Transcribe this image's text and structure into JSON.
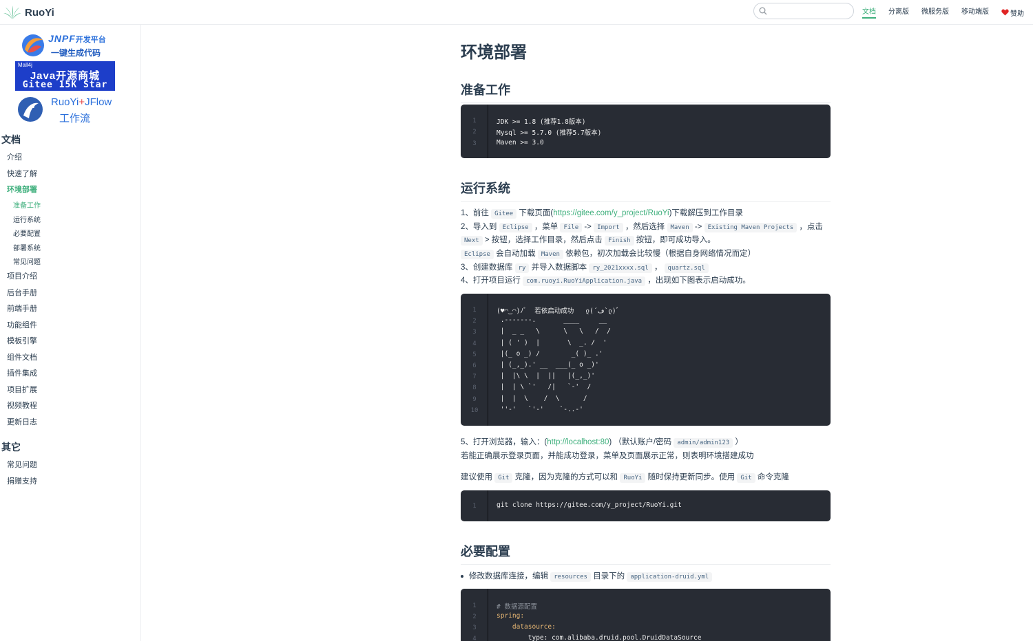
{
  "navbar": {
    "brand": "RuoYi",
    "search_value": "",
    "links": [
      "文档",
      "分离版",
      "微服务版",
      "移动端版"
    ],
    "sponsor": "赞助"
  },
  "sidebar": {
    "ads": {
      "jnpf_title": "JNPF",
      "jnpf_title_suffix": "开发平台",
      "jnpf_sub": "一键生成代码",
      "mall_small": "Mall4j",
      "mall_a": "Java开源商城",
      "mall_b": "Gitee 15K Star",
      "flow_a1": "RuoYi",
      "flow_plus": "+",
      "flow_a2": "JFlow",
      "flow_b": "工作流"
    },
    "group_docs": "文档",
    "items": [
      "介绍",
      "快速了解",
      "环境部署"
    ],
    "sub_items": [
      "准备工作",
      "运行系统",
      "必要配置",
      "部署系统",
      "常见问题"
    ],
    "items2": [
      "项目介绍",
      "后台手册",
      "前端手册",
      "功能组件",
      "模板引擎",
      "组件文档",
      "插件集成",
      "项目扩展",
      "视频教程",
      "更新日志"
    ],
    "group_other": "其它",
    "other_items": [
      "常见问题",
      "捐赠支持"
    ]
  },
  "content": {
    "title": "环境部署",
    "h_prepare": "准备工作",
    "prepare_code": [
      "JDK >= 1.8 (推荐1.8版本)",
      "Mysql >= 5.7.0 (推荐5.7版本)",
      "Maven >= 3.0"
    ],
    "h_run": "运行系统",
    "run": {
      "l1_a": "1、前往",
      "l1_code": "Gitee",
      "l1_b": "下载页面(",
      "l1_link": "https://gitee.com/y_project/RuoYi",
      "l1_c": ")下载解压到工作目录",
      "l2_a": "2、导入到",
      "l2_code1": "Eclipse",
      "l2_b": "，菜单",
      "l2_code2": "File",
      "l2_arrow1": "->",
      "l2_code3": "Import",
      "l2_c": "，然后选择",
      "l2_code4": "Maven",
      "l2_arrow2": "->",
      "l2_code5": "Existing Maven Projects",
      "l2_d": "，点击",
      "l3_code1": "Next",
      "l3_a": "> 按钮，选择工作目录，然后点击",
      "l3_code2": "Finish",
      "l3_b": "按钮，即可成功导入。",
      "l4_code1": "Eclipse",
      "l4_a": "会自动加载",
      "l4_code2": "Maven",
      "l4_b": "依赖包，初次加载会比较慢（根据自身网络情况而定）",
      "l5_a": "3、创建数据库",
      "l5_code1": "ry",
      "l5_b": "并导入数据脚本",
      "l5_code2": "ry_2021xxxx.sql",
      "l5_c": "，",
      "l5_code3": "quartz.sql",
      "l6_a": "4、打开项目运行",
      "l6_code": "com.ruoyi.RuoYiApplication.java",
      "l6_b": "，出现如下图表示启动成功。"
    },
    "ascii_code": [
      "(♥◠‿◠)ﾉﾞ  若依启动成功   ლ(´ڡ`ლ)ﾞ",
      " .-------.       ____     __",
      " |  _ _   \\      \\   \\   /  /",
      " | ( ' )  |       \\  _. /  '",
      " |(_ o _) /        _( )_ .'",
      " | (_,_).' __  ___(_ o _)'",
      " |  |\\ \\  |  ||   |(_,_)'",
      " |  | \\ `'   /|   `-'  /",
      " |  |  \\    /  \\      /",
      " ''-'   `'-'    `-..-'"
    ],
    "after": {
      "l1_a": "5、打开浏览器，输入：(",
      "l1_link": "http://localhost:80",
      "l1_b": ") （默认账户/密码",
      "l1_code": "admin/admin123",
      "l1_c": "）",
      "l2": "若能正确展示登录页面，并能成功登录，菜单及页面展示正常，则表明环境搭建成功",
      "l3_a": "建议使用",
      "l3_code1": "Git",
      "l3_b": "克隆，因为克隆的方式可以和",
      "l3_code2": "RuoYi",
      "l3_c": "随时保持更新同步。使用",
      "l3_code3": "Git",
      "l3_d": "命令克隆"
    },
    "git_code": [
      "git clone https://gitee.com/y_project/RuoYi.git"
    ],
    "h_config": "必要配置",
    "config": {
      "a": "修改数据库连接，编辑",
      "code1": "resources",
      "b": "目录下的",
      "code2": "application-druid.yml"
    },
    "yml_code": [
      "# 数据源配置",
      "spring:",
      "    datasource:",
      "        type: com.alibaba.druid.pool.DruidDataSource"
    ]
  },
  "colors": {
    "accent": "#3eaf7c",
    "code_bg": "#282c34",
    "text": "#2c3e50",
    "ad_blue": "#1d3ec9"
  }
}
